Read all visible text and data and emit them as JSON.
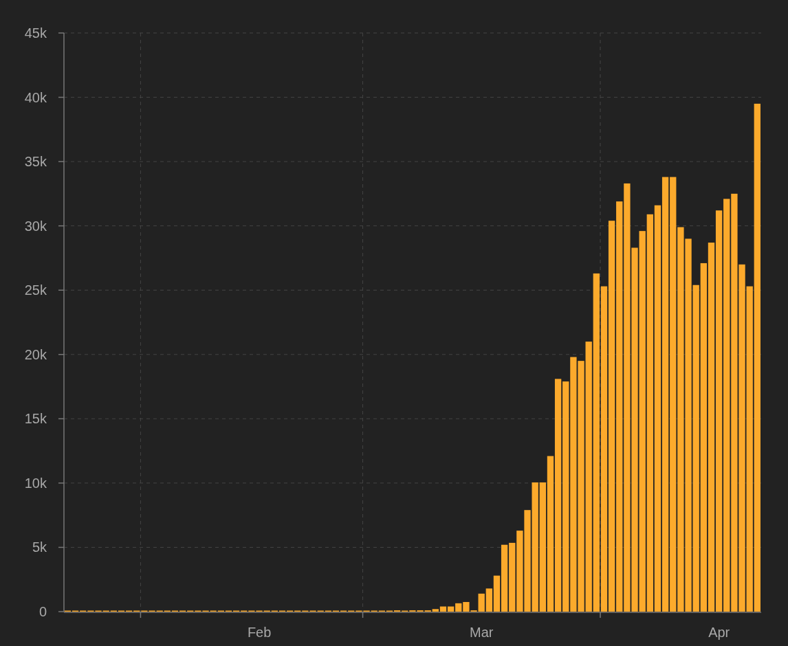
{
  "chart_data": {
    "type": "bar",
    "categories": [
      null,
      null,
      null,
      null,
      null,
      null,
      null,
      null,
      null,
      null,
      null,
      null,
      null,
      null,
      null,
      null,
      null,
      null,
      null,
      null,
      null,
      null,
      null,
      null,
      null,
      "Feb",
      null,
      null,
      null,
      null,
      null,
      null,
      null,
      null,
      null,
      null,
      null,
      null,
      null,
      null,
      null,
      null,
      null,
      null,
      null,
      null,
      null,
      null,
      null,
      null,
      null,
      null,
      null,
      null,
      "Mar",
      null,
      null,
      null,
      null,
      null,
      null,
      null,
      null,
      null,
      null,
      null,
      null,
      null,
      null,
      null,
      null,
      null,
      null,
      null,
      null,
      null,
      null,
      null,
      null,
      null,
      null,
      null,
      null,
      null,
      null,
      "Apr",
      null,
      null,
      null,
      null,
      null
    ],
    "grid": true,
    "series": [
      {
        "color": "#fcaa2c",
        "values": [
          0,
          0,
          0,
          0,
          0,
          0,
          0,
          0,
          0,
          0,
          0,
          0,
          0,
          0,
          0,
          0,
          0,
          0,
          0,
          0,
          0,
          0,
          0,
          0,
          0,
          0,
          0,
          0,
          0,
          0,
          0,
          0,
          0,
          0,
          0,
          0,
          0,
          0,
          0,
          0,
          0,
          0,
          0,
          100,
          0,
          100,
          100,
          100,
          200,
          400,
          400,
          650,
          750,
          100,
          1400,
          1800,
          2800,
          5200,
          5350,
          6300,
          7900,
          10050,
          10050,
          12100,
          18100,
          17900,
          19800,
          19500,
          21000,
          26300,
          25300,
          30400,
          31900,
          33300,
          28300,
          29600,
          30900,
          31600,
          33800,
          33800,
          29900,
          29000,
          25400,
          27100,
          28700,
          31200,
          32100,
          32500,
          27000,
          25300,
          39500
        ]
      }
    ],
    "ylim": [
      0,
      45000
    ],
    "yticks": [
      {
        "value": 0,
        "label": "0"
      },
      {
        "value": 5000,
        "label": "5k"
      },
      {
        "value": 10000,
        "label": "10k"
      },
      {
        "value": 15000,
        "label": "15k"
      },
      {
        "value": 20000,
        "label": "20k"
      },
      {
        "value": 25000,
        "label": "25k"
      },
      {
        "value": 30000,
        "label": "30k"
      },
      {
        "value": 35000,
        "label": "35k"
      },
      {
        "value": 40000,
        "label": "40k"
      },
      {
        "value": 45000,
        "label": "45k"
      }
    ]
  }
}
